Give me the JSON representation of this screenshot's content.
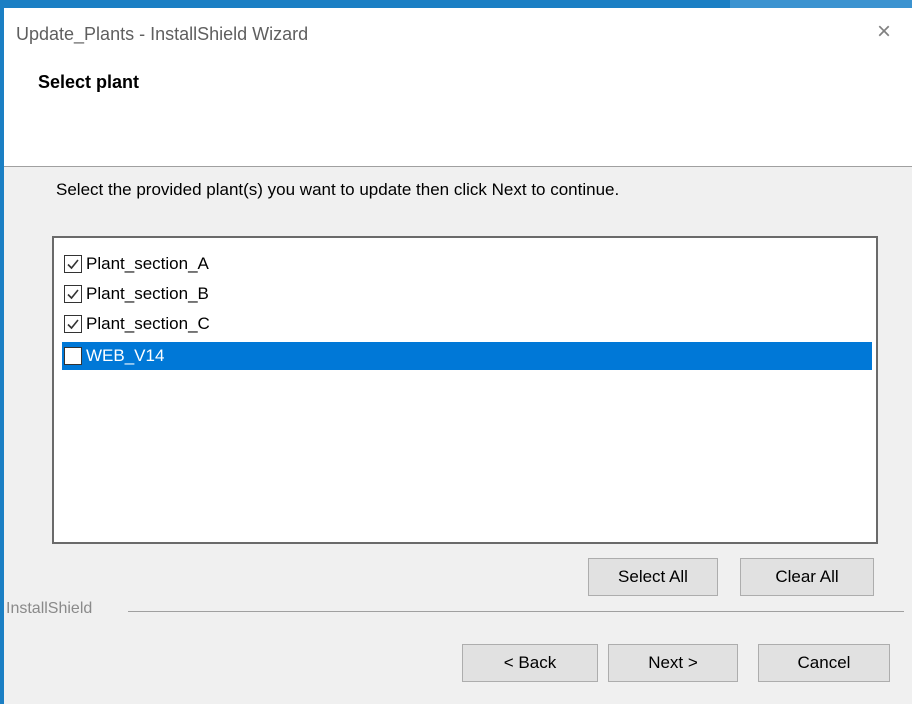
{
  "window": {
    "title": "Update_Plants - InstallShield Wizard",
    "close_glyph": "×"
  },
  "header": {
    "step_title": "Select plant"
  },
  "main": {
    "instruction": "Select the provided plant(s) you want to update then click Next to continue.",
    "plants": [
      {
        "label": "Plant_section_A",
        "checked": true,
        "selected": false
      },
      {
        "label": "Plant_section_B",
        "checked": true,
        "selected": false
      },
      {
        "label": "Plant_section_C",
        "checked": true,
        "selected": false
      },
      {
        "label": "WEB_V14",
        "checked": false,
        "selected": true
      }
    ],
    "select_all_label": "Select All",
    "clear_all_label": "Clear All"
  },
  "footer": {
    "brand": "InstallShield",
    "back_label": "< Back",
    "next_label": "Next >",
    "cancel_label": "Cancel"
  },
  "colors": {
    "accent": "#1b7fc4",
    "selection": "#0078d7"
  }
}
